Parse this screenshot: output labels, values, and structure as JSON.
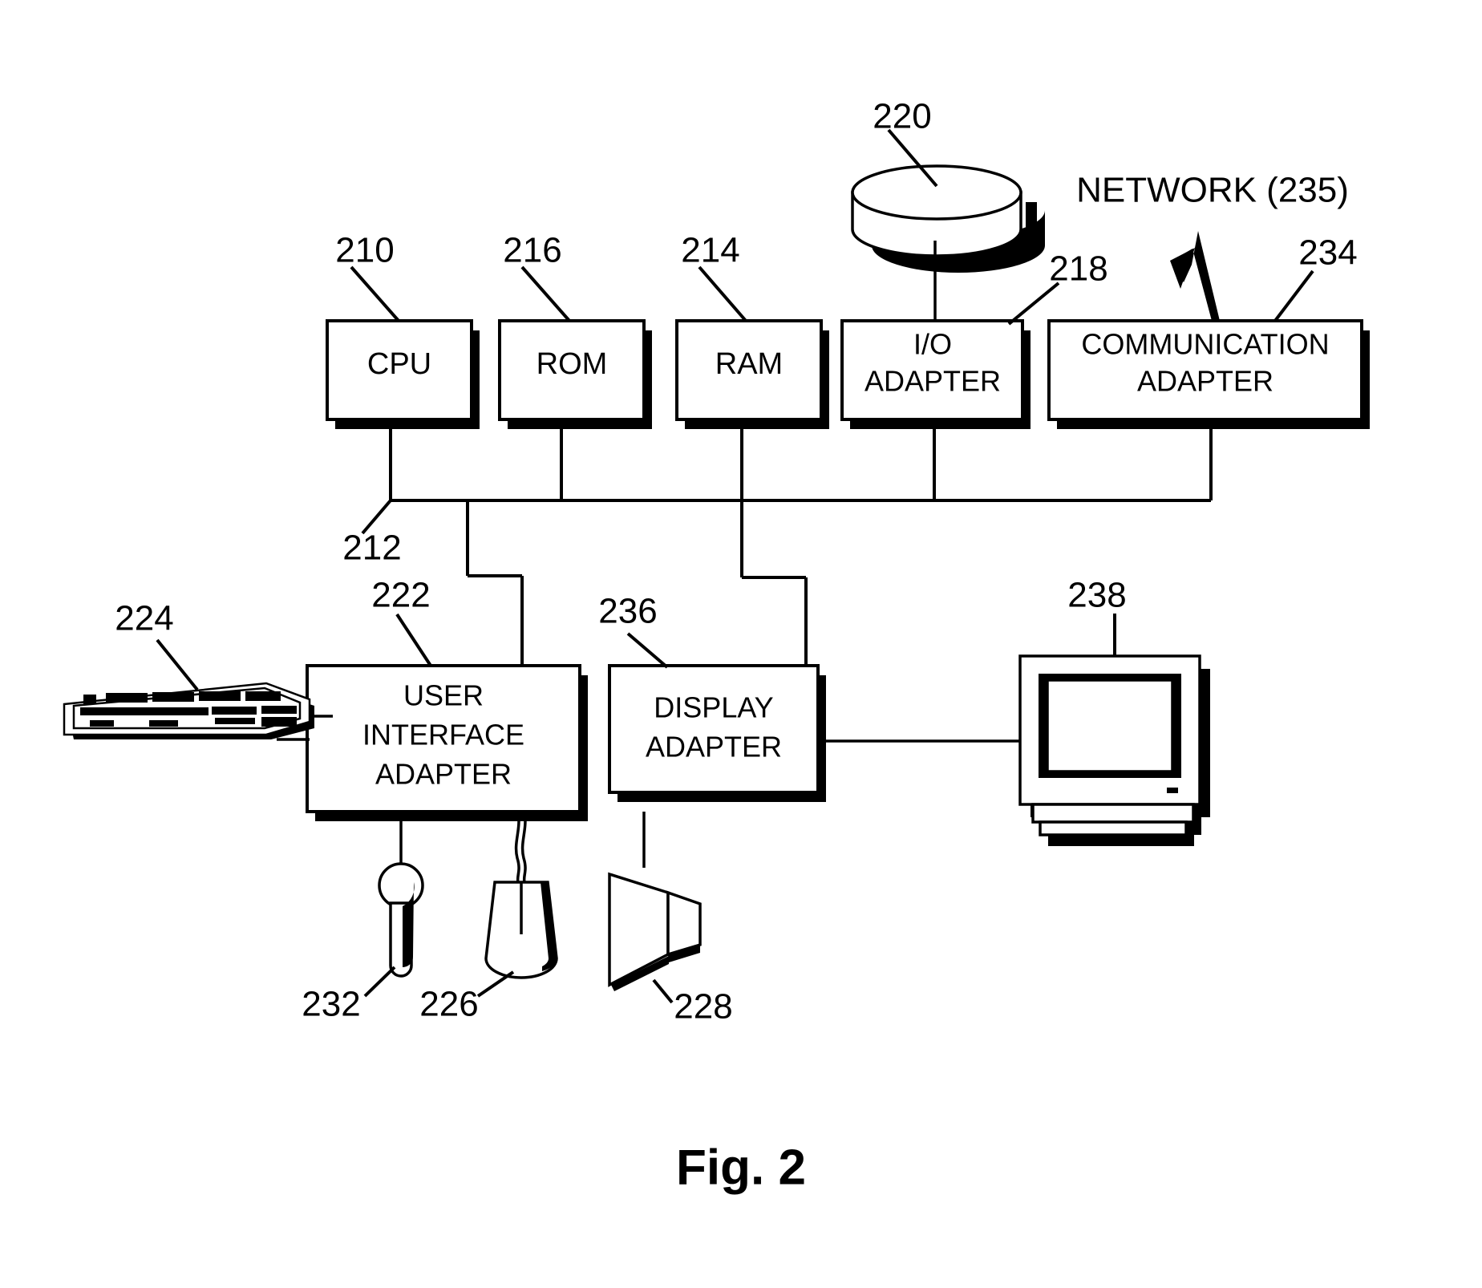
{
  "figure": {
    "caption": "Fig. 2",
    "type": "patent-block-diagram"
  },
  "boxes": [
    {
      "id": "cpu",
      "label_lines": [
        "CPU"
      ],
      "ref": "210"
    },
    {
      "id": "rom",
      "label_lines": [
        "ROM"
      ],
      "ref": "216"
    },
    {
      "id": "ram",
      "label_lines": [
        "RAM"
      ],
      "ref": "214"
    },
    {
      "id": "io",
      "label_lines": [
        "I/O",
        "ADAPTER"
      ],
      "ref": "218"
    },
    {
      "id": "comm",
      "label_lines": [
        "COMMUNICATION",
        "ADAPTER"
      ],
      "ref": "234"
    },
    {
      "id": "uia",
      "label_lines": [
        "USER",
        "INTERFACE",
        "ADAPTER"
      ],
      "ref": "222"
    },
    {
      "id": "display",
      "label_lines": [
        "DISPLAY",
        "ADAPTER"
      ],
      "ref": "236"
    }
  ],
  "devices": [
    {
      "id": "disk",
      "name": "disk-storage-icon",
      "ref": "220"
    },
    {
      "id": "keyboard",
      "name": "keyboard-icon",
      "ref": "224"
    },
    {
      "id": "joystick",
      "name": "joystick-icon",
      "ref": "232"
    },
    {
      "id": "mouse",
      "name": "mouse-icon",
      "ref": "226"
    },
    {
      "id": "speaker",
      "name": "speaker-icon",
      "ref": "228"
    },
    {
      "id": "monitor",
      "name": "monitor-icon",
      "ref": "238"
    }
  ],
  "bus": {
    "ref": "212",
    "name": "system-bus"
  },
  "network": {
    "label": "NETWORK (235)",
    "ref_in_label": "235",
    "icon": "lightning-bolt-icon"
  },
  "refs": {
    "cpu": "210",
    "bus": "212",
    "ram": "214",
    "rom": "216",
    "io_adapter": "218",
    "disk": "220",
    "user_interface_adapter": "222",
    "keyboard": "224",
    "mouse": "226",
    "speaker": "228",
    "joystick": "232",
    "communication_adapter": "234",
    "network": "235",
    "display_adapter": "236",
    "monitor": "238"
  },
  "colors": {
    "ink": "#000000",
    "paper": "#ffffff"
  }
}
